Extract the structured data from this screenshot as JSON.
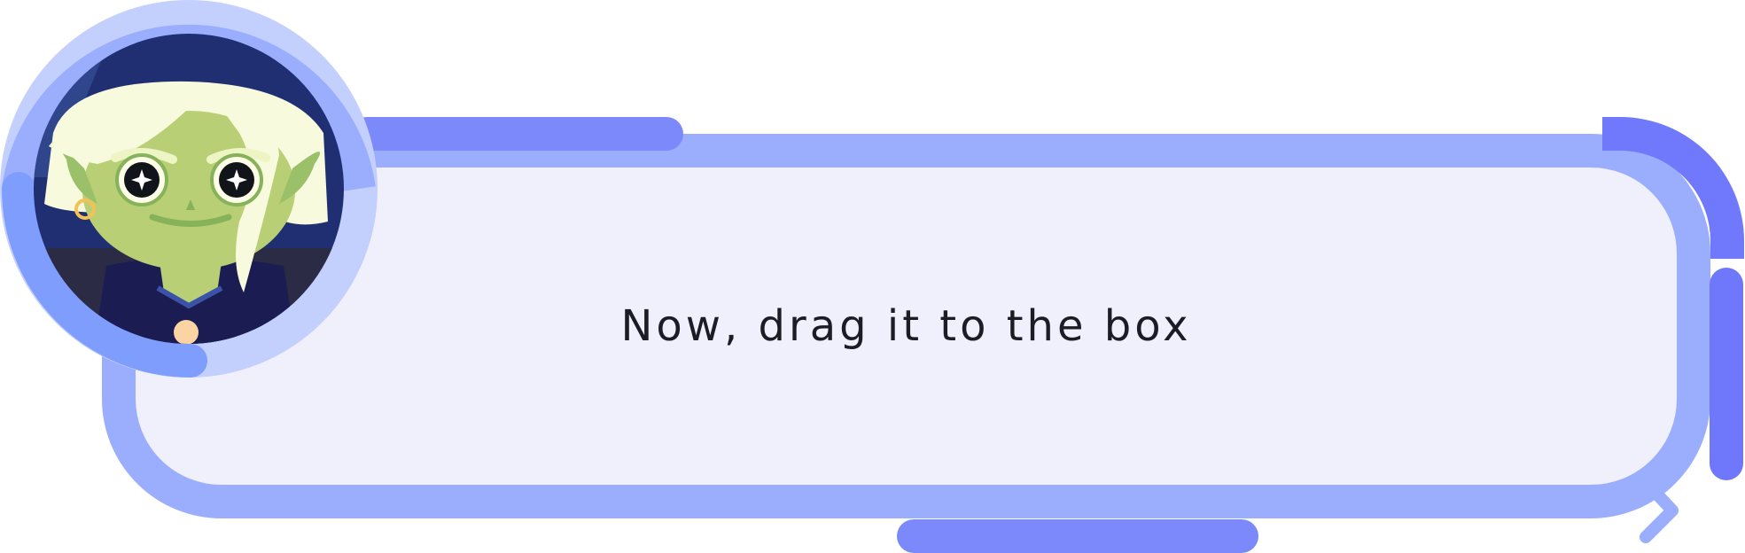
{
  "dialog": {
    "text": "Now, drag it to the box"
  },
  "icons": {
    "next": "chevron-right-icon",
    "avatar": "goblin-character-portrait"
  },
  "colors": {
    "frame": "#9aaefd",
    "frame_accent": "#7c89fb",
    "dialog_bg": "#eff0fc",
    "text": "#1c1c24"
  }
}
